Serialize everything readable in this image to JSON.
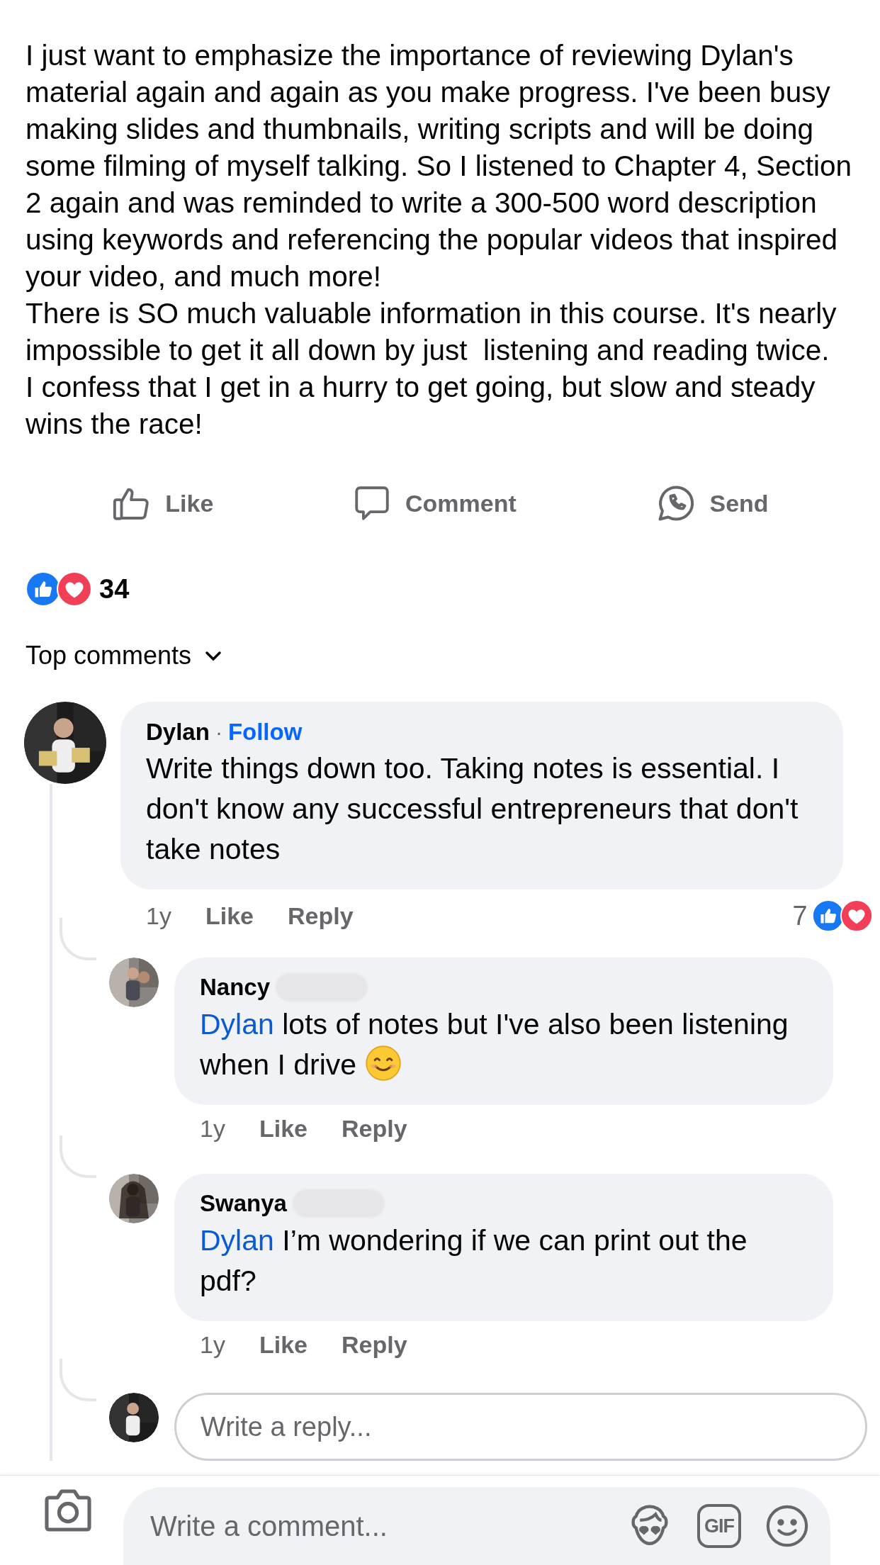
{
  "post": {
    "paragraphs": [
      "I just want to emphasize the importance of reviewing Dylan's material again and again as you make progress. I've been busy making slides and thumbnails, writing scripts and will be doing some filming of myself talking. So I listened to Chapter 4, Section 2 again and was reminded to write a 300-500 word description using keywords and referencing the popular videos that inspired your video, and much more!",
      "There is SO much valuable information in this course. It's nearly impossible to get it all down by just  listening and reading twice.",
      "I confess that I get in a hurry to get going, but slow and steady wins the race!"
    ]
  },
  "actions": [
    {
      "kind": "like",
      "label": "Like"
    },
    {
      "kind": "comment",
      "label": "Comment"
    },
    {
      "kind": "send",
      "label": "Send"
    }
  ],
  "reactions": {
    "count": "34"
  },
  "sort": {
    "label": "Top comments"
  },
  "comments": [
    {
      "author": "Dylan",
      "separator": "·",
      "follow": "Follow",
      "text": "Write things down too. Taking notes is essential. I don't know any successful entrepreneurs that don't take notes",
      "time": "1y",
      "actions": [
        "Like",
        "Reply"
      ],
      "reaction_count": "7",
      "replies": [
        {
          "author": "Nancy",
          "surname_hidden": true,
          "mention": "Dylan",
          "text": "lots of notes but I've also been listening when I drive",
          "smiley": true,
          "time": "1y",
          "actions": [
            "Like",
            "Reply"
          ]
        },
        {
          "author": "Swanya",
          "surname_hidden": true,
          "mention": "Dylan",
          "text": "I’m wondering if we can print out the pdf?",
          "time": "1y",
          "actions": [
            "Like",
            "Reply"
          ]
        }
      ],
      "reply_box": {
        "placeholder": "Write a reply..."
      }
    }
  ],
  "composer": {
    "placeholder": "Write a comment...",
    "gif": "GIF"
  }
}
